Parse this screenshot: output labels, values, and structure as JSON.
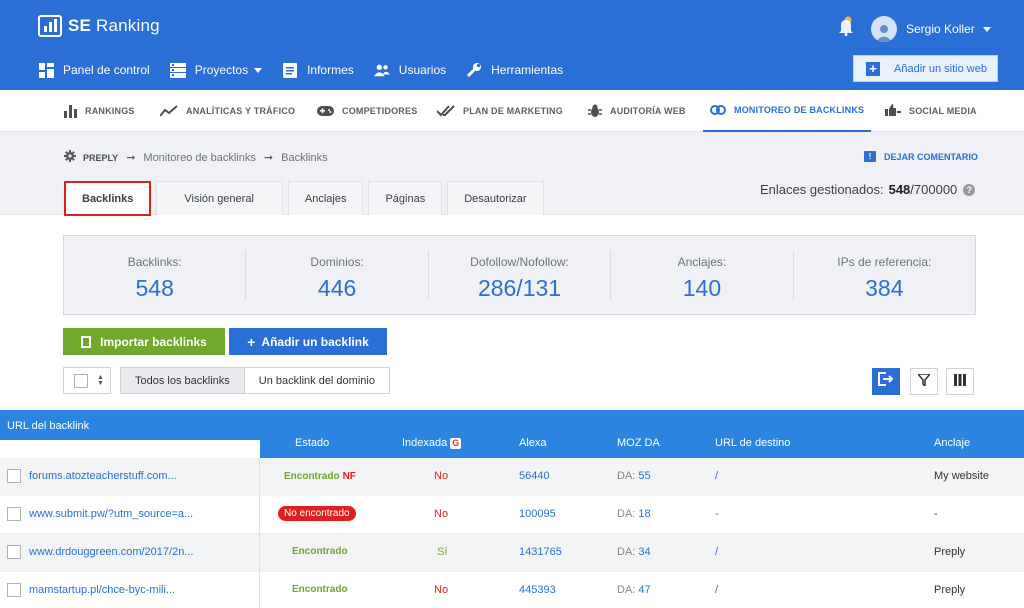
{
  "app": {
    "brand_bold": "SE",
    "brand_rest": " Ranking",
    "user_name": "Sergio Koller",
    "add_site_label": "Añadir un sitio web"
  },
  "main_nav": [
    {
      "label": "Panel de control",
      "icon": "dashboard-icon"
    },
    {
      "label": "Proyectos",
      "icon": "projects-icon"
    },
    {
      "label": "Informes",
      "icon": "reports-icon"
    },
    {
      "label": "Usuarios",
      "icon": "users-icon"
    },
    {
      "label": "Herramientas",
      "icon": "tools-icon"
    }
  ],
  "modules": [
    {
      "label": "RANKINGS"
    },
    {
      "label": "ANALÍTICAS Y TRÁFICO"
    },
    {
      "label": "COMPETIDORES"
    },
    {
      "label": "PLAN DE MARKETING"
    },
    {
      "label": "AUDITORÍA WEB"
    },
    {
      "label": "MONITOREO DE BACKLINKS"
    },
    {
      "label": "SOCIAL MEDIA"
    }
  ],
  "breadcrumb": {
    "project": "PREPLY",
    "section": "Monitoreo de backlinks",
    "page": "Backlinks"
  },
  "comment_label": "DEJAR COMENTARIO",
  "tabs": [
    {
      "label": "Backlinks"
    },
    {
      "label": "Visión general"
    },
    {
      "label": "Anclajes"
    },
    {
      "label": "Páginas"
    },
    {
      "label": "Desautorizar"
    }
  ],
  "managed": {
    "label": "Enlaces gestionados:",
    "value": "548",
    "total": "/700000"
  },
  "stats": [
    {
      "label": "Backlinks:",
      "value": "548"
    },
    {
      "label": "Dominios:",
      "value": "446"
    },
    {
      "label": "Dofollow/Nofollow:",
      "value": "286/131"
    },
    {
      "label": "Anclajes:",
      "value": "140"
    },
    {
      "label": "IPs de referencia:",
      "value": "384"
    }
  ],
  "buttons": {
    "import": "Importar backlinks",
    "add": "Añadir un backlink"
  },
  "filters": {
    "all": "Todos los backlinks",
    "one_per_domain": "Un backlink del dominio"
  },
  "table": {
    "headers": {
      "url": "URL del backlink",
      "status": "Estado",
      "indexed": "Indexada",
      "alexa": "Alexa",
      "moz": "MOZ DA",
      "dest": "URL de destino",
      "anchor": "Anclaje"
    },
    "rows": [
      {
        "url": "forums.atozteacherstuff.com...",
        "status": "Encontrado",
        "status_flag": "NF",
        "indexed": "No",
        "alexa": "56440",
        "moz_prefix": "DA:",
        "moz": "55",
        "dest": "/",
        "anchor": "My website"
      },
      {
        "url": "www.submit.pw/?utm_source=a...",
        "status": "No encontrado",
        "status_flag": "",
        "indexed": "No",
        "alexa": "100095",
        "moz_prefix": "DA:",
        "moz": "18",
        "dest": "-",
        "anchor": "-"
      },
      {
        "url": "www.drdouggreen.com/2017/2n...",
        "status": "Encontrado",
        "status_flag": "",
        "indexed": "Sí",
        "alexa": "1431765",
        "moz_prefix": "DA:",
        "moz": "34",
        "dest": "/",
        "anchor": "Preply"
      },
      {
        "url": "mamstartup.pl/chce-byc-mili...",
        "status": "Encontrado",
        "status_flag": "",
        "indexed": "No",
        "alexa": "445393",
        "moz_prefix": "DA:",
        "moz": "47",
        "dest": "/",
        "anchor": "Preply"
      }
    ]
  },
  "colors": {
    "brand_blue": "#2a6fd6",
    "table_header": "#2a84e0",
    "green": "#6fa82b",
    "red": "#e02020"
  }
}
